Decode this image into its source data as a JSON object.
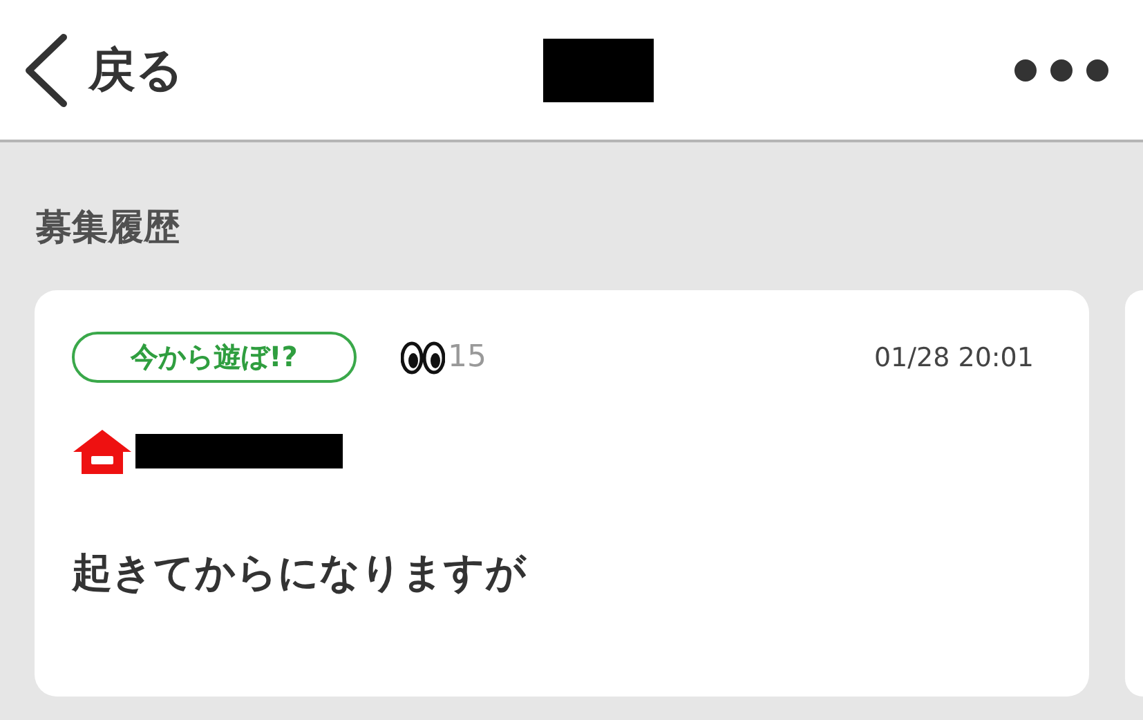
{
  "header": {
    "back_label": "戻る"
  },
  "section_title": "募集履歴",
  "posts": [
    {
      "tag": "今から遊ぼ!?",
      "views": "15",
      "time": "01/28 20:01",
      "message": "起きてからになりますが"
    }
  ]
}
